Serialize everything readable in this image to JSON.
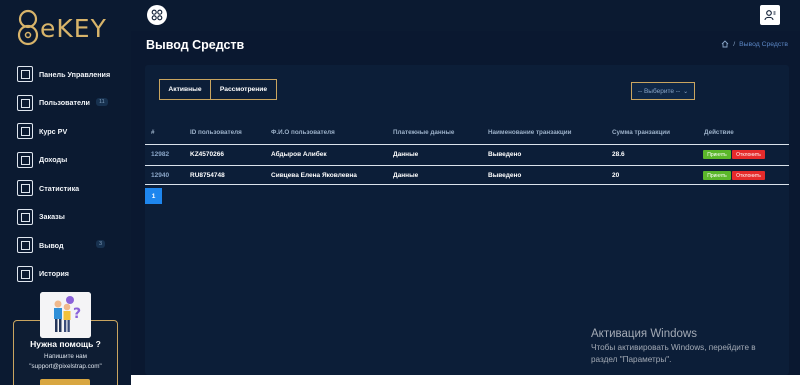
{
  "brand": {
    "logo_text": "eKEY"
  },
  "sidebar": {
    "items": [
      {
        "label": "Панель Управления",
        "icon": "dashboard-icon"
      },
      {
        "label": "Пользователи",
        "icon": "users-icon",
        "badge": "11"
      },
      {
        "label": "Курс PV",
        "icon": "rate-icon"
      },
      {
        "label": "Доходы",
        "icon": "income-icon"
      },
      {
        "label": "Статистика",
        "icon": "statistics-icon"
      },
      {
        "label": "Заказы",
        "icon": "orders-icon"
      },
      {
        "label": "Вывод",
        "icon": "withdraw-icon",
        "badge": "3"
      },
      {
        "label": "История",
        "icon": "history-icon"
      }
    ],
    "help": {
      "title": "Нужна помощь ?",
      "line1": "Напишите нам",
      "line2": "\"support@pixelstrap.com\""
    }
  },
  "header": {
    "page_title": "Вывод Средств",
    "breadcrumb_sep": "/",
    "breadcrumb_current": "Вывод Средств"
  },
  "tabs": {
    "active": "Активные",
    "review": "Рассмотрение"
  },
  "filter": {
    "placeholder": "-- Выберите --"
  },
  "table": {
    "headers": [
      "#",
      "ID пользователя",
      "Ф.И.О пользователя",
      "Платежные данные",
      "Наименование транзакции",
      "Сумма транзакции",
      "Действие"
    ],
    "rows": [
      {
        "num": "12982",
        "user_id": "KZ4570266",
        "name": "Абдыров Алибек",
        "payment": "Данные",
        "transaction": "Выведено",
        "amount": "28.6",
        "accept": "Принять",
        "reject": "Отклонить"
      },
      {
        "num": "12940",
        "user_id": "RU8754748",
        "name": "Сивцева Елена Яковлевна",
        "payment": "Данные",
        "transaction": "Выведено",
        "amount": "20",
        "accept": "Принять",
        "reject": "Отклонить"
      }
    ]
  },
  "pagination": {
    "current": "1"
  },
  "windows_watermark": {
    "title": "Активация Windows",
    "line1": "Чтобы активировать Windows, перейдите в",
    "line2": "раздел \"Параметры\"."
  },
  "colors": {
    "accent_gold": "#c9a560",
    "accept_green": "#5bb82a",
    "reject_red": "#e52b2b",
    "pager_blue": "#1e86ee",
    "background": "#0a1830"
  }
}
